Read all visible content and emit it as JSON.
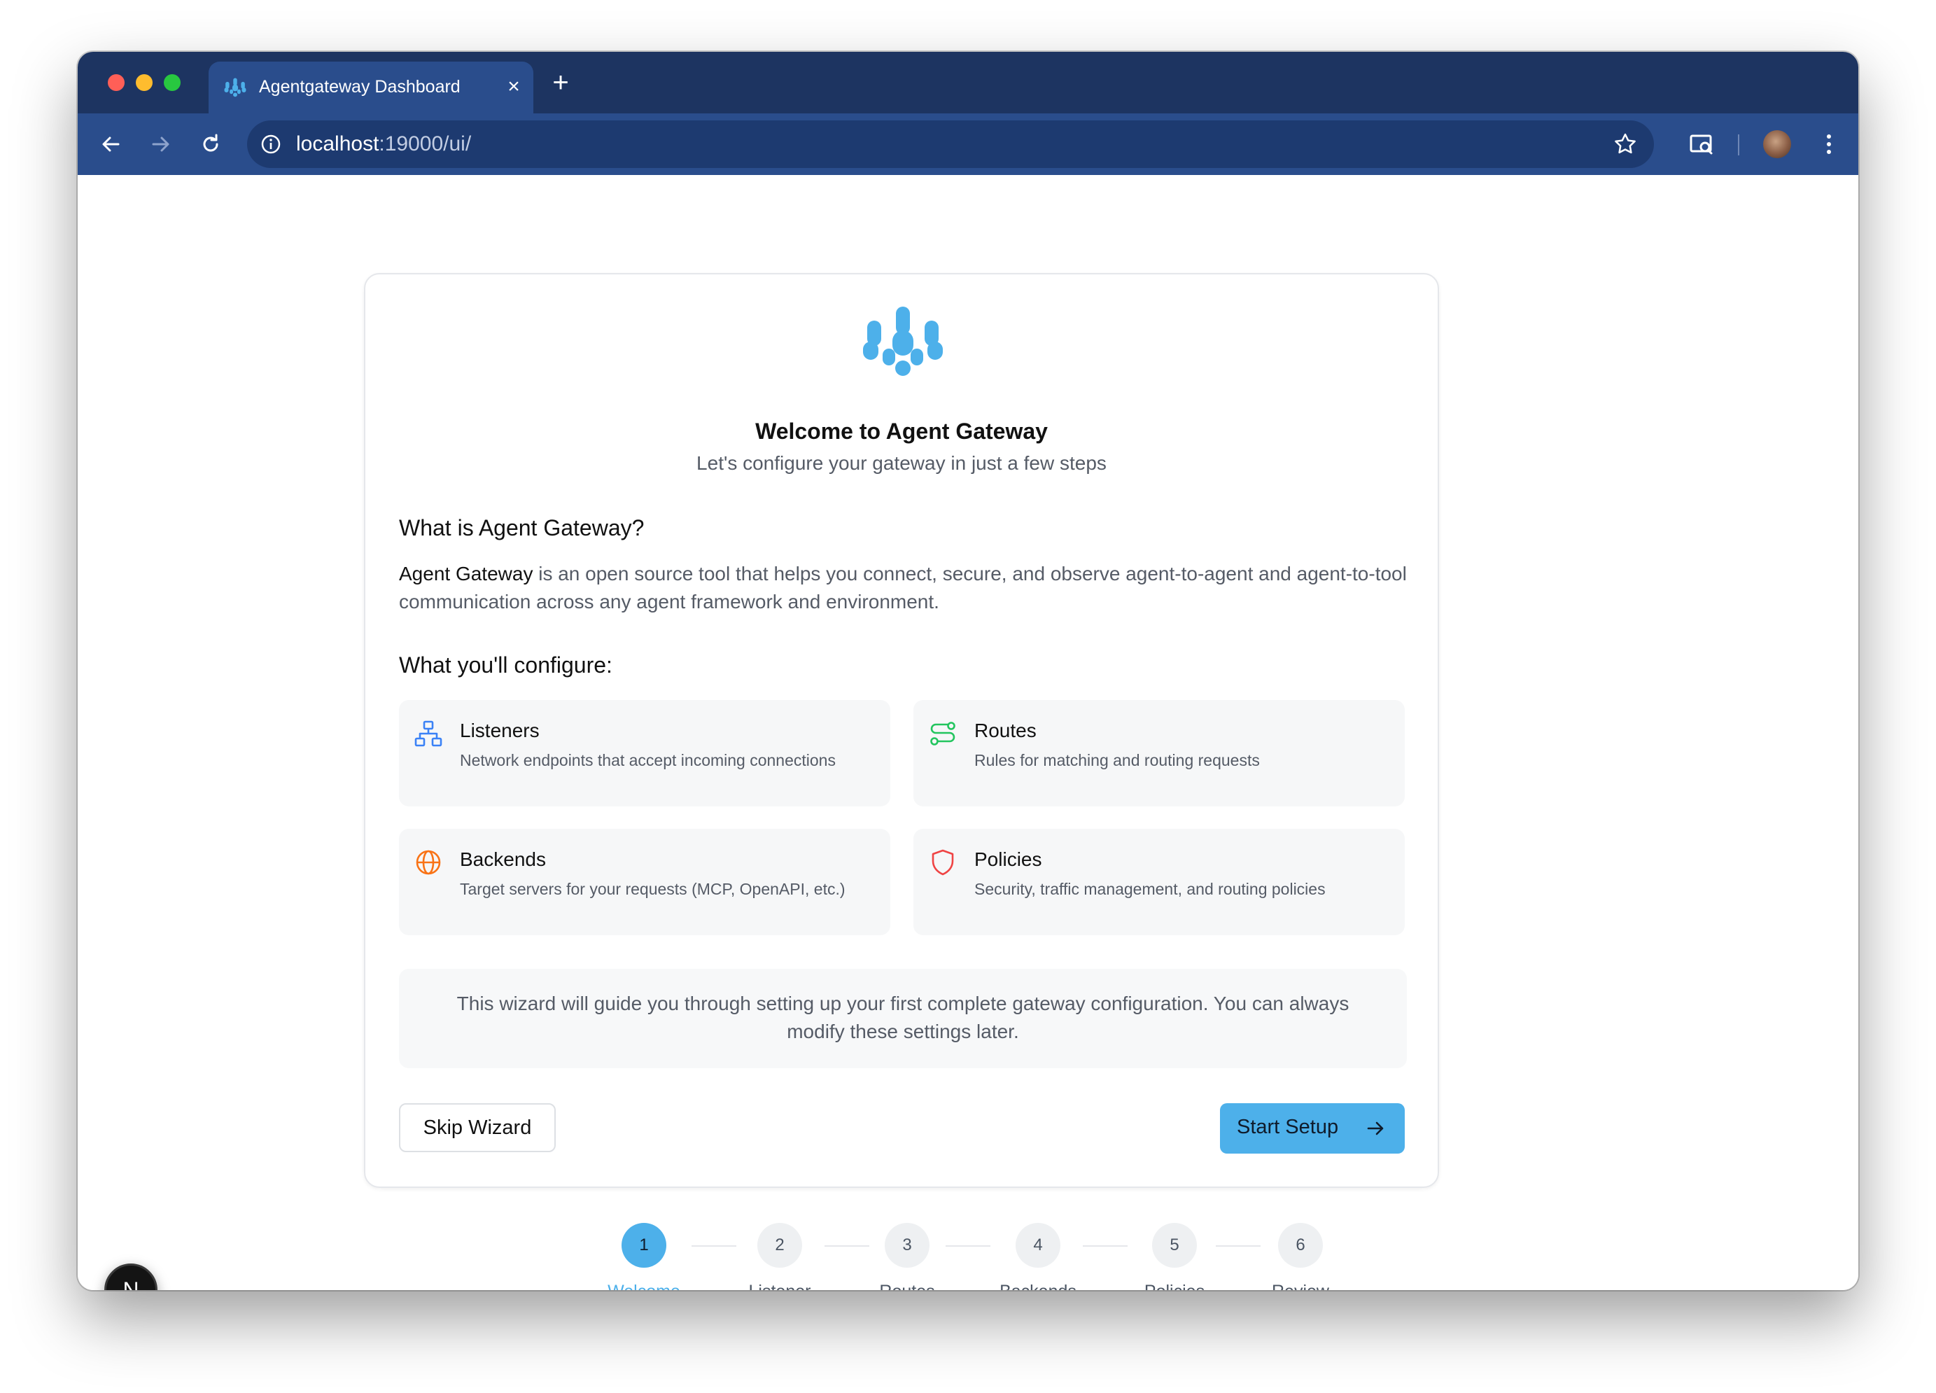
{
  "browser": {
    "tab_title": "Agentgateway Dashboard",
    "tab_close": "×",
    "new_tab": "+",
    "url_host": "localhost",
    "url_path": ":19000/ui/"
  },
  "hero": {
    "title": "Welcome to Agent Gateway",
    "subtitle": "Let's configure your gateway in just a few steps"
  },
  "about": {
    "heading": "What is Agent Gateway?",
    "name": "Agent Gateway",
    "text": " is an open source tool that helps you connect, secure, and observe agent-to-agent and agent-to-tool communication across any agent framework and environment."
  },
  "configure": {
    "heading": "What you'll configure:",
    "items": [
      {
        "title": "Listeners",
        "description": "Network endpoints that accept incoming connections",
        "icon": "network-icon",
        "color": "#3b82f6"
      },
      {
        "title": "Routes",
        "description": "Rules for matching and routing requests",
        "icon": "route-icon",
        "color": "#22c55e"
      },
      {
        "title": "Backends",
        "description": "Target servers for your requests (MCP, OpenAPI, etc.)",
        "icon": "globe-icon",
        "color": "#f97316"
      },
      {
        "title": "Policies",
        "description": "Security, traffic management, and routing policies",
        "icon": "shield-icon",
        "color": "#ef4444"
      }
    ]
  },
  "note": "This wizard will guide you through setting up your first complete gateway configuration. You can always modify these settings later.",
  "actions": {
    "skip": "Skip Wizard",
    "start": "Start Setup"
  },
  "steps": [
    {
      "number": "1",
      "label": "Welcome",
      "active": true
    },
    {
      "number": "2",
      "label": "Listener",
      "active": false
    },
    {
      "number": "3",
      "label": "Routes",
      "active": false
    },
    {
      "number": "4",
      "label": "Backends",
      "active": false
    },
    {
      "number": "5",
      "label": "Policies",
      "active": false
    },
    {
      "number": "6",
      "label": "Review",
      "active": false
    }
  ],
  "dev_badge": "N",
  "colors": {
    "brand": "#4db0ea",
    "chrome_frame": "#1d3461",
    "chrome_toolbar": "#2a4d8c"
  }
}
